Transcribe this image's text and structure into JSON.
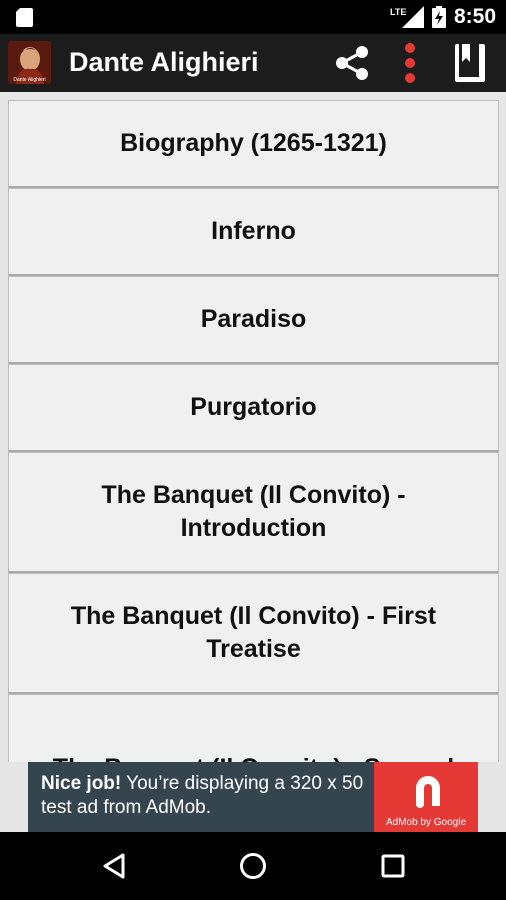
{
  "status_bar": {
    "time": "8:50",
    "network": "LTE"
  },
  "app_bar": {
    "title": "Dante Alighieri",
    "logo_caption": "Dante Alighieri"
  },
  "menu": {
    "items": [
      {
        "label": "Biography (1265-1321)"
      },
      {
        "label": "Inferno"
      },
      {
        "label": "Paradiso"
      },
      {
        "label": "Purgatorio"
      },
      {
        "label": "The Banquet (Il Convito) - Introduction"
      },
      {
        "label": "The Banquet (Il Convito) - First Treatise"
      },
      {
        "label": "The Banquet (Il Convito) - Second"
      }
    ]
  },
  "ad": {
    "headline": "Nice job!",
    "body": " You’re displaying a 320 x 50 test ad from AdMob.",
    "badge": "AdMob by Google"
  },
  "colors": {
    "accent_red": "#e53935",
    "app_bar": "#1c1c1c",
    "ad_background": "#35454f"
  }
}
